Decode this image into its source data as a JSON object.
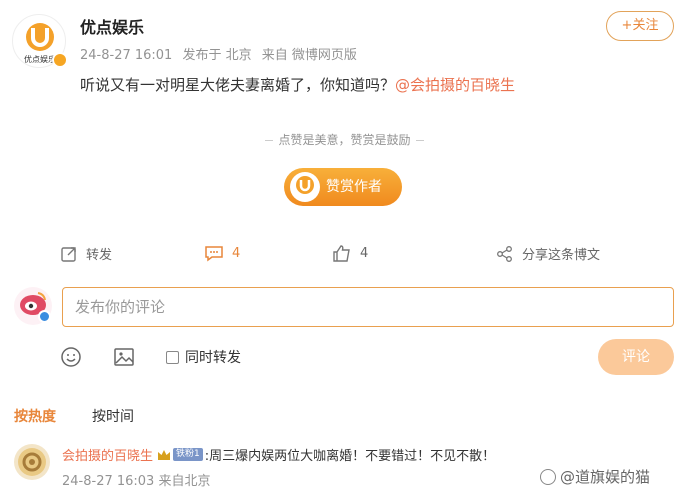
{
  "post": {
    "author": "优点娱乐",
    "avatar_text": "优点娱乐",
    "date": "24-8-27 16:01",
    "posted_from": "发布于 北京",
    "source": "来自 微博网页版",
    "text_main": "听说又有一对明星大佬夫妻离婚了，你知道吗？",
    "mention": "@会拍摄的百晓生"
  },
  "header": {
    "follow_label": "+关注"
  },
  "reward": {
    "slogan": "点赞是美意，赞赏是鼓励",
    "button_label": "赞赏作者"
  },
  "actions": {
    "repost_label": "转发",
    "comment_count": "4",
    "like_count": "4",
    "share_label": "分享这条博文"
  },
  "comment_box": {
    "placeholder": "发布你的评论",
    "also_repost_label": "同时转发",
    "submit_label": "评论"
  },
  "tabs": {
    "hot": "按热度",
    "time": "按时间"
  },
  "comment": {
    "author": "会拍摄的百晓生",
    "fan_badge": "铁粉1",
    "text": ":周三爆内娱两位大咖离婚！不要错过！不见不散！",
    "date": "24-8-27 16:03",
    "location": "来自北京"
  },
  "watermark": "@道旗娱的猫",
  "colors": {
    "accent": "#e8863a",
    "mention": "#eb7350",
    "submit_disabled": "#fbc99a"
  }
}
